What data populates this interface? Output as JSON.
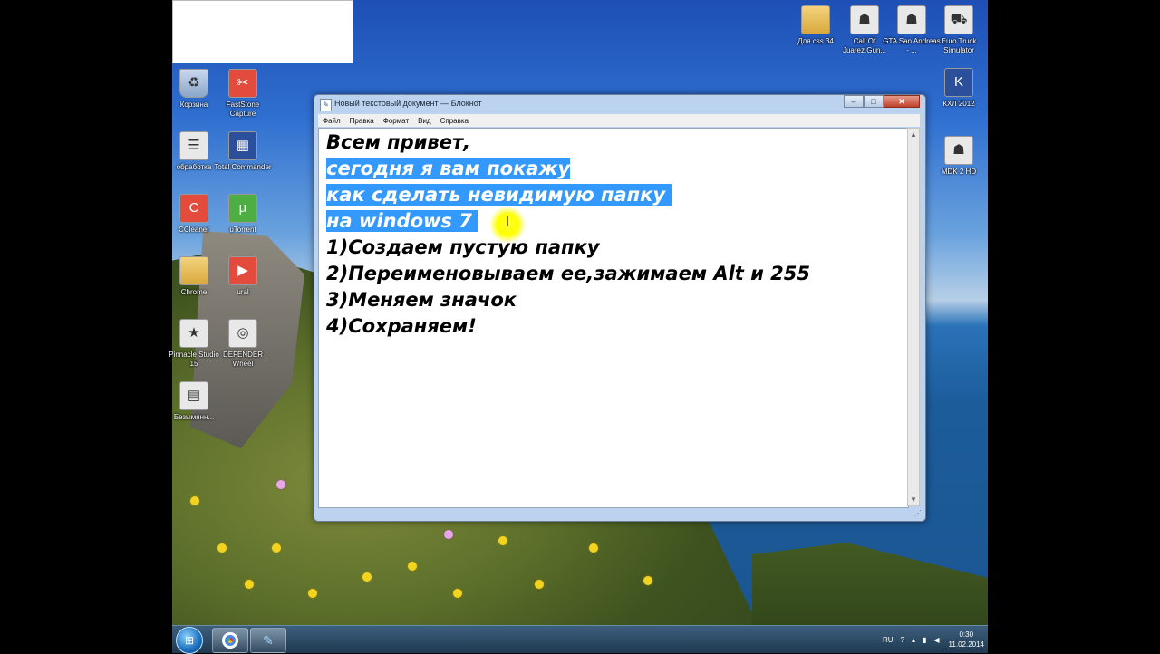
{
  "notepad": {
    "title": "Новый текстовый документ — Блокнот",
    "menu": [
      "Файл",
      "Правка",
      "Формат",
      "Вид",
      "Справка"
    ],
    "lines": [
      {
        "text": "Всем привет,",
        "selected": false
      },
      {
        "text": "сегодня я вам покажу",
        "selected": true
      },
      {
        "text": "как сделать невидимую папку ",
        "selected": true
      },
      {
        "text": "на windows 7 ",
        "selected": true
      },
      {
        "text": "1)Создаем пустую папку",
        "selected": false
      },
      {
        "text": "2)Переименовываем ее,зажимаем Alt и 255",
        "selected": false
      },
      {
        "text": "3)Меняем значок",
        "selected": false
      },
      {
        "text": "4)Сохраняем!",
        "selected": false
      }
    ]
  },
  "desktop_icons_left": [
    {
      "label": "Корзина",
      "icon": "recycle-bin-icon"
    },
    {
      "label": "FastStone Capture",
      "icon": "faststone-icon"
    },
    {
      "label": "обработка",
      "icon": "document-icon"
    },
    {
      "label": "Total Commander",
      "icon": "total-commander-icon"
    },
    {
      "label": "CCleaner",
      "icon": "ccleaner-icon"
    },
    {
      "label": "uTorrent",
      "icon": "utorrent-icon"
    },
    {
      "label": "Chrome",
      "icon": "folder-icon"
    },
    {
      "label": "ural",
      "icon": "media-icon"
    },
    {
      "label": "Pinnacle Studio 15",
      "icon": "pinnacle-icon"
    },
    {
      "label": "DEFENDER Wheel",
      "icon": "defender-icon"
    },
    {
      "label": "Безымянн...",
      "icon": "image-file-icon"
    }
  ],
  "desktop_icons_right": [
    {
      "label": "Для css 34",
      "icon": "folder-icon"
    },
    {
      "label": "Call Of Juarez.Gun...",
      "icon": "game-icon"
    },
    {
      "label": "GTA San Andreas - ...",
      "icon": "game-icon"
    },
    {
      "label": "Euro Truck Simulator",
      "icon": "game-icon"
    },
    {
      "label": "КХЛ 2012",
      "icon": "khl-icon"
    },
    {
      "label": "MDK 2 HD",
      "icon": "game-icon"
    }
  ],
  "taskbar": {
    "language": "RU",
    "time": "0:30",
    "date": "11.02.2014"
  }
}
